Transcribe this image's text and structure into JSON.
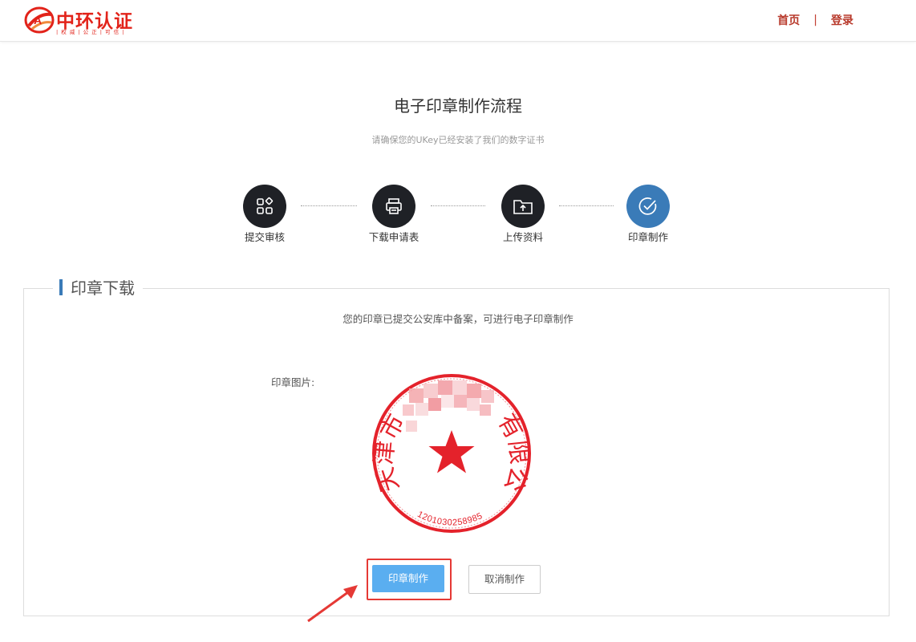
{
  "header": {
    "logo_name": "中环认证",
    "logo_tagline": "| 权 威 | 公 正 | 可 信 |",
    "nav_home": "首页",
    "nav_separator": "|",
    "nav_login": "登录"
  },
  "page": {
    "title": "电子印章制作流程",
    "subtitle": "请确保您的UKey已经安装了我们的数字证书"
  },
  "steps": [
    {
      "label": "提交审核",
      "icon": "apps-grid-icon",
      "active": false
    },
    {
      "label": "下载申请表",
      "icon": "printer-icon",
      "active": false
    },
    {
      "label": "上传资料",
      "icon": "folder-upload-icon",
      "active": false
    },
    {
      "label": "印章制作",
      "icon": "check-circle-icon",
      "active": true
    }
  ],
  "panel": {
    "legend": "印章下载",
    "notice": "您的印章已提交公安库中备案，可进行电子印章制作",
    "seal_label": "印章图片:",
    "seal": {
      "left_text": "天津市",
      "right_text": "有限公司",
      "code": "1201030258985",
      "color": "#e4222b"
    }
  },
  "buttons": {
    "make": "印章制作",
    "cancel": "取消制作"
  },
  "colors": {
    "brand": "#e2231a",
    "accent_blue": "#3a7bb8",
    "button_blue": "#5aaef0",
    "highlight": "#e53935"
  }
}
